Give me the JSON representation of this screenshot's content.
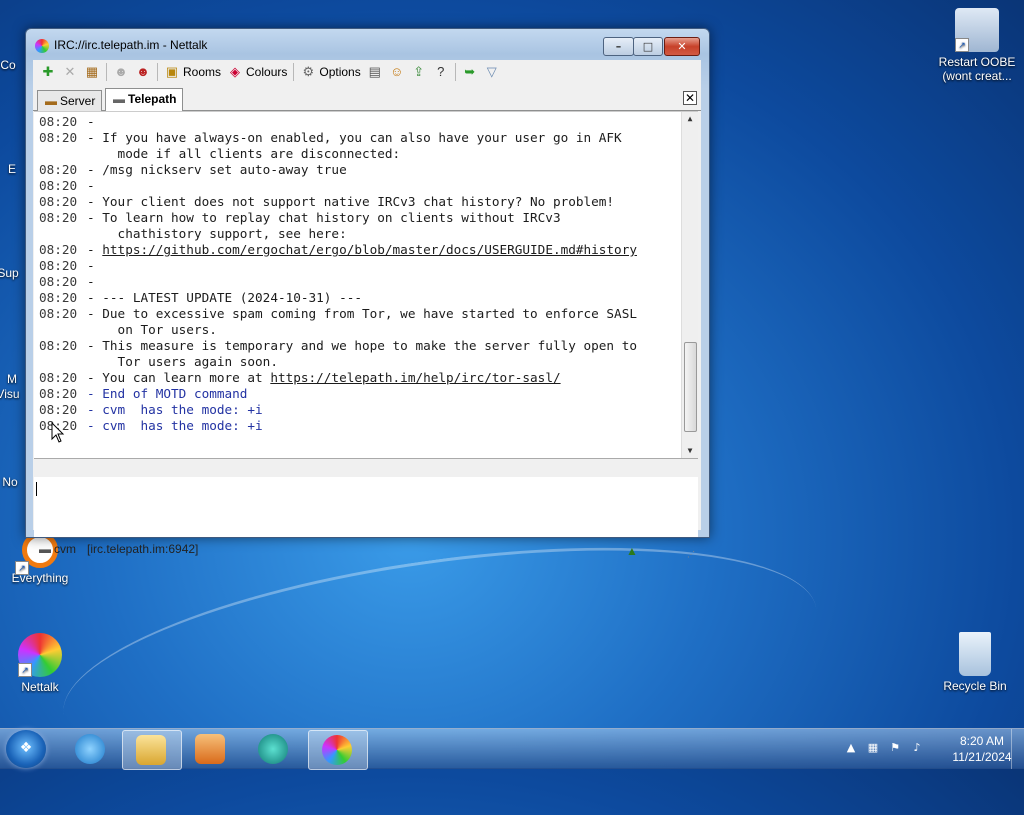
{
  "window": {
    "title": "IRC://irc.telepath.im  -  Nettalk"
  },
  "toolbar": {
    "rooms_label": "Rooms",
    "colours_label": "Colours",
    "options_label": "Options"
  },
  "tabs": {
    "server_label": "Server",
    "telepath_label": "Telepath"
  },
  "chat": {
    "lines": [
      {
        "ts": "08:20",
        "msg": "-"
      },
      {
        "ts": "08:20",
        "msg": "- If you have always-on enabled, you can also have your user go in AFK"
      },
      {
        "ts": "",
        "msg": "    mode if all clients are disconnected:"
      },
      {
        "ts": "08:20",
        "msg": "- /msg nickserv set auto-away true"
      },
      {
        "ts": "08:20",
        "msg": "-"
      },
      {
        "ts": "08:20",
        "msg": "- Your client does not support native IRCv3 chat history? No problem!"
      },
      {
        "ts": "08:20",
        "msg": "- To learn how to replay chat history on clients without IRCv3"
      },
      {
        "ts": "",
        "msg": "    chathistory support, see here:"
      },
      {
        "ts": "08:20",
        "msg": "- ",
        "link": "https://github.com/ergochat/ergo/blob/master/docs/USERGUIDE.md#history"
      },
      {
        "ts": "08:20",
        "msg": "-"
      },
      {
        "ts": "08:20",
        "msg": "-"
      },
      {
        "ts": "08:20",
        "msg": "- --- LATEST UPDATE (2024-10-31) ---"
      },
      {
        "ts": "08:20",
        "msg": "- Due to excessive spam coming from Tor, we have started to enforce SASL"
      },
      {
        "ts": "",
        "msg": "    on Tor users."
      },
      {
        "ts": "08:20",
        "msg": "- This measure is temporary and we hope to make the server fully open to"
      },
      {
        "ts": "",
        "msg": "    Tor users again soon."
      },
      {
        "ts": "08:20",
        "msg": "- You can learn more at ",
        "link": "https://telepath.im/help/irc/tor-sasl/"
      },
      {
        "ts": "08:20",
        "msg": "- End of MOTD command",
        "blue": true
      },
      {
        "ts": "08:20",
        "msg": "- cvm  has the mode: +i",
        "blue": true
      },
      {
        "ts": "08:20",
        "msg": "- cvm  has the mode: +i",
        "blue": true
      }
    ]
  },
  "status": {
    "nick": "cvm",
    "server": "[irc.telepath.im:6942]"
  },
  "desktop": {
    "restart_oobe_label": "Restart OOBE (wont creat...",
    "everything_label": "Everything",
    "nettalk_label": "Nettalk",
    "recycle_bin_label": "Recycle Bin",
    "left_labels": [
      "Co",
      "E",
      "Sup",
      "M",
      "Visu",
      "No"
    ]
  },
  "taskbar": {
    "time": "8:20 AM",
    "date": "11/21/2024"
  },
  "colors": {
    "link_text": "#1c1c1c",
    "server_notice_blue": "#2333a3"
  }
}
